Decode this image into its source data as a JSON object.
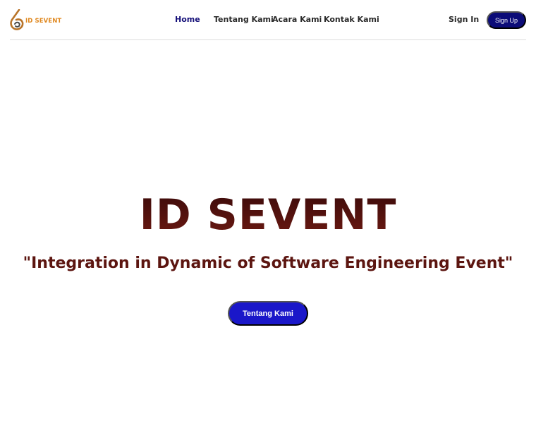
{
  "brand": {
    "logo_text": "ID SEVENT",
    "accent_color": "#e0881f"
  },
  "nav": {
    "items": [
      {
        "label": "Home",
        "active": true
      },
      {
        "label": "Tentang Kami",
        "active": false
      },
      {
        "label": "Acara Kami",
        "active": false
      },
      {
        "label": "Kontak Kami",
        "active": false
      }
    ],
    "active_color": "#17127a"
  },
  "auth": {
    "sign_in_label": "Sign In",
    "sign_up_label": "Sign Up",
    "sign_up_color": "#0c0c78"
  },
  "hero": {
    "title": "ID SEVENT",
    "tagline": "\"Integration in Dynamic of Software Engineering Event\"",
    "cta_label": "Tentang Kami",
    "cta_color": "#1a17c9",
    "title_color": "#5a1010"
  }
}
